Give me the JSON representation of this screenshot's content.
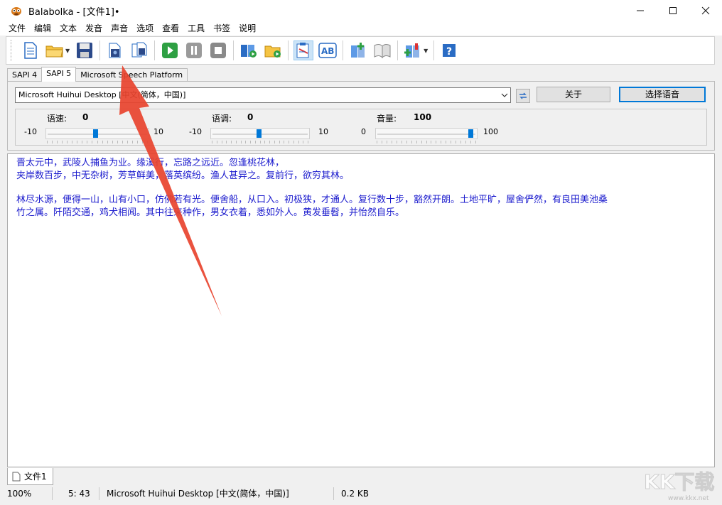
{
  "window": {
    "title": "Balabolka - [文件1]•",
    "controls": [
      "minimize",
      "maximize",
      "close"
    ]
  },
  "menu": [
    "文件",
    "编辑",
    "文本",
    "发音",
    "声音",
    "选项",
    "查看",
    "工具",
    "书签",
    "说明"
  ],
  "toolbar": {
    "buttons": [
      "new-document-icon",
      "open-folder-icon",
      "save-icon",
      "save-audio-icon",
      "split-audio-icon",
      "play-icon",
      "pause-icon",
      "stop-icon",
      "book-play-icon",
      "book-folder-icon",
      "clipboard-read-icon",
      "ab-translate-icon",
      "add-book-icon",
      "open-book-icon",
      "add-bookmark-icon",
      "help-icon"
    ],
    "active": "clipboard-read-icon"
  },
  "tabs": [
    "SAPI 4",
    "SAPI 5",
    "Microsoft Speech Platform"
  ],
  "selected_tab": "SAPI 5",
  "voice": {
    "selected": "Microsoft Huihui Desktop [中文(简体，中国)]",
    "about_label": "关于",
    "select_label": "选择语音"
  },
  "sliders": {
    "rate": {
      "label": "语速:",
      "value": "0",
      "min": "-10",
      "max": "10"
    },
    "pitch": {
      "label": "语调:",
      "value": "0",
      "min": "-10",
      "max": "10"
    },
    "volume": {
      "label": "音量:",
      "value": "100",
      "min": "0",
      "max": "100"
    }
  },
  "editor": {
    "lines": [
      "晋太元中，武陵人捕鱼为业。缘溪行，忘路之远近。忽逢桃花林，",
      "夹岸数百步，中无杂树，芳草鲜美，落英缤纷。渔人甚异之。复前行，欲穷其林。",
      "",
      "林尽水源，便得一山，山有小口，仿佛若有光。便舍船，从口入。初极狭，才通人。复行数十步，豁然开朗。土地平旷，屋舍俨然，有良田美池桑",
      "竹之属。阡陌交通，鸡犬相闻。其中往来种作，男女衣着，悉如外人。黄发垂髫，并怡然自乐。"
    ]
  },
  "document_tab": "文件1",
  "status": {
    "zoom": "100%",
    "cursor": "5:  43",
    "voice": "Microsoft Huihui Desktop [中文(简体，中国)]",
    "size": "0.2 KB"
  },
  "watermark": {
    "text": "KK下载",
    "url": "www.kkx.net"
  },
  "colors": {
    "accent": "#0078d7",
    "text_blue": "#1a1acd",
    "annotation_arrow": "#e8432e"
  }
}
